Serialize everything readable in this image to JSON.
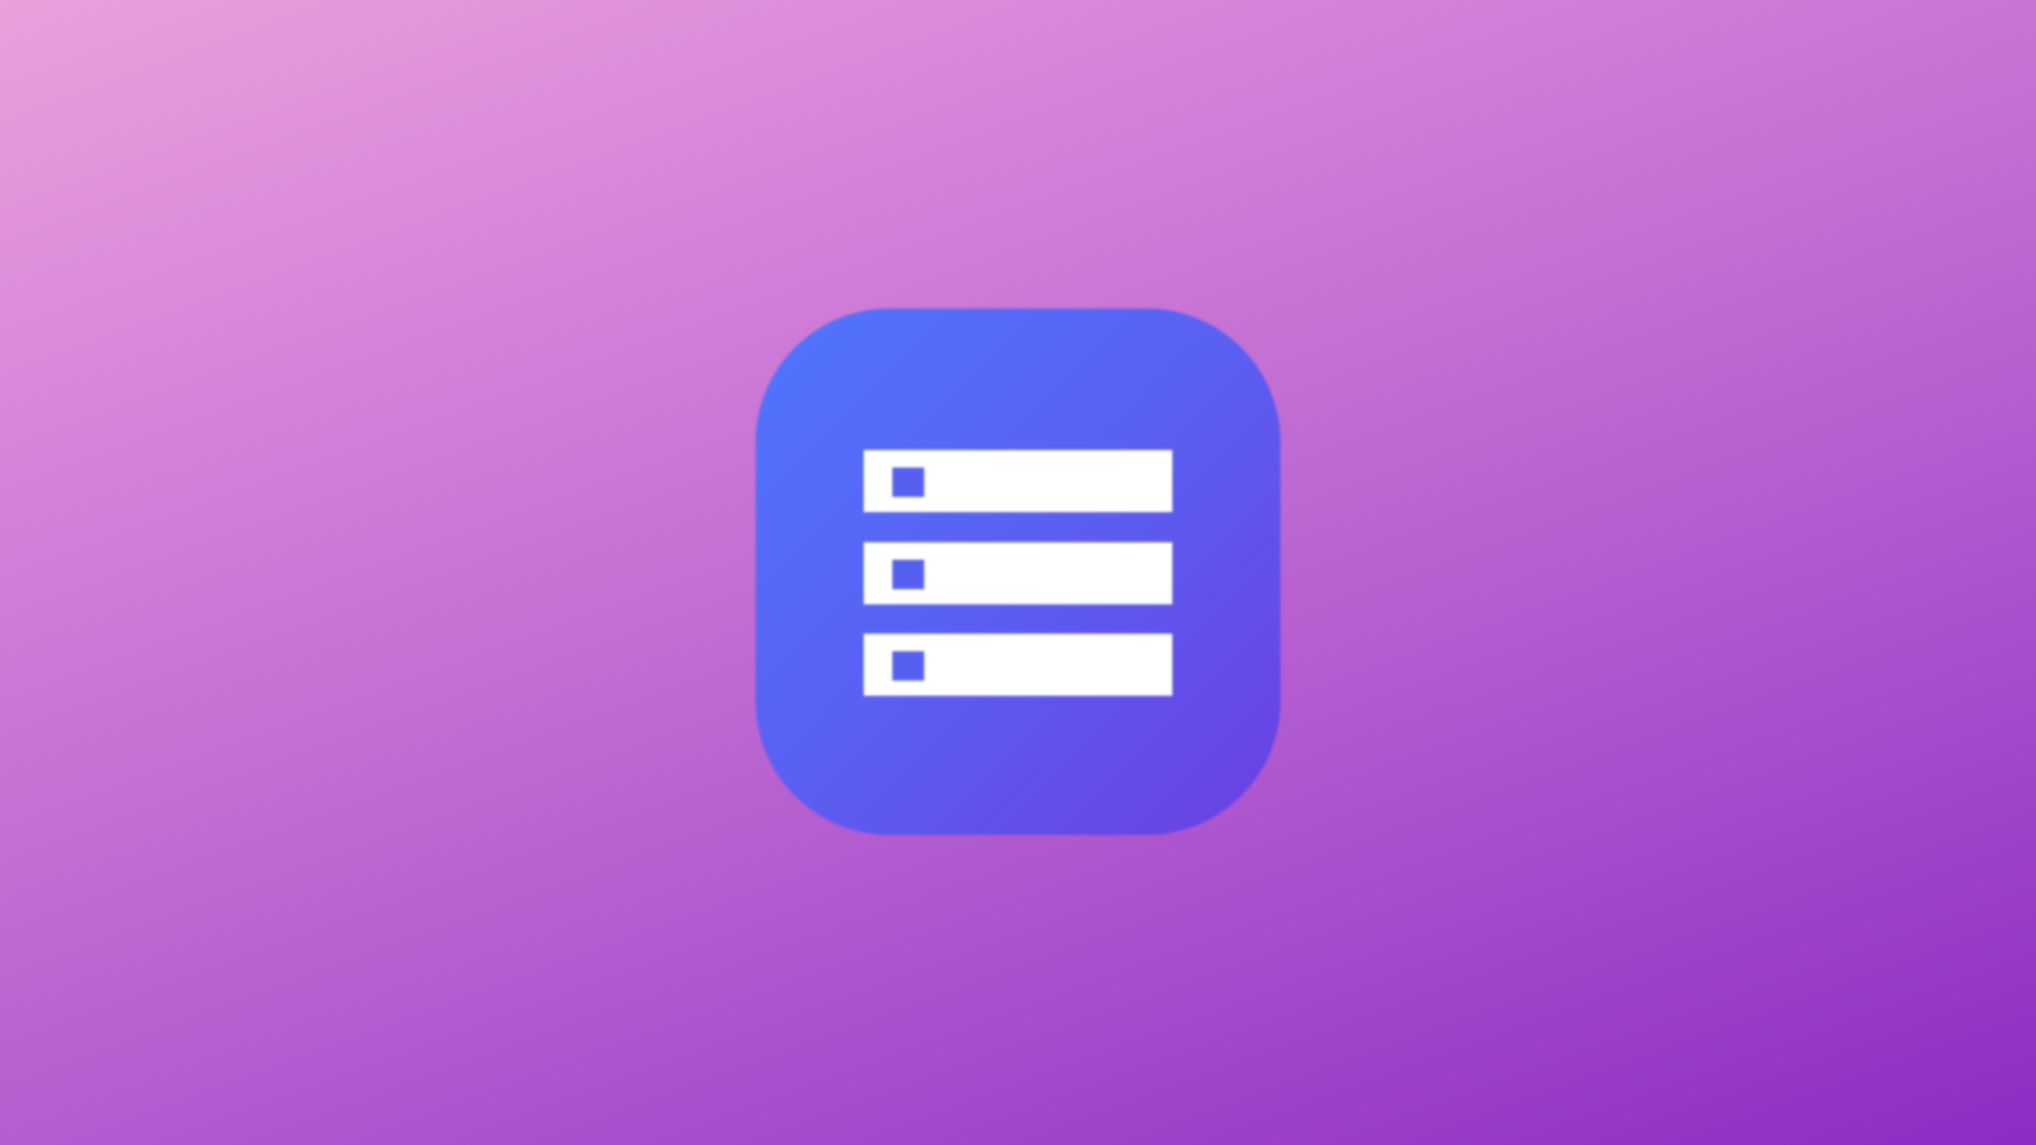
{
  "splash": {
    "background_gradient": [
      "#e9a0dc",
      "#d787d9",
      "#c06bd3",
      "#a850cd",
      "#8e2bc4"
    ],
    "app_icon": {
      "icon": "server-stack-icon",
      "gradient": [
        "#4f76ff",
        "#5a60f2",
        "#6b3fe2"
      ],
      "glyph_color": "#ffffff",
      "indicator_color": "#5660f0",
      "rows": 3
    }
  }
}
